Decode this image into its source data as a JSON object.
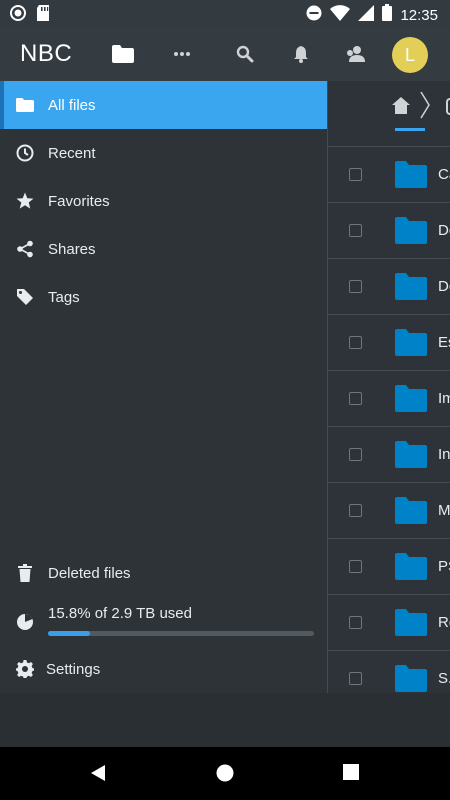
{
  "status_bar": {
    "time": "12:35",
    "icons": [
      "app-notification-icon",
      "sd-card-icon",
      "do-not-disturb-icon",
      "wifi-icon",
      "signal-icon",
      "battery-icon"
    ]
  },
  "header": {
    "brand": "NBC",
    "icons": [
      "folder-icon",
      "more-icon",
      "search-icon",
      "notifications-icon",
      "contacts-icon"
    ],
    "avatar_letter": "L",
    "avatar_color": "#e3cf57"
  },
  "drawer": {
    "items": [
      {
        "label": "All files",
        "icon": "folder-icon",
        "active": true
      },
      {
        "label": "Recent",
        "icon": "clock-icon"
      },
      {
        "label": "Favorites",
        "icon": "star-icon"
      },
      {
        "label": "Shares",
        "icon": "share-icon"
      },
      {
        "label": "Tags",
        "icon": "tag-icon"
      }
    ],
    "deleted_label": "Deleted files",
    "quota_label": "15.8% of 2.9 TB used",
    "quota_fraction": 0.158,
    "settings_label": "Settings"
  },
  "files": {
    "names": [
      "Ca",
      "Do",
      "Do",
      "Es",
      "Im",
      "In",
      "M",
      "PS",
      "Re",
      "S."
    ]
  },
  "colors": {
    "accent": "#3aa6ef",
    "folder": "#0082c9",
    "header": "#343b41",
    "drawer": "#2e3338"
  }
}
